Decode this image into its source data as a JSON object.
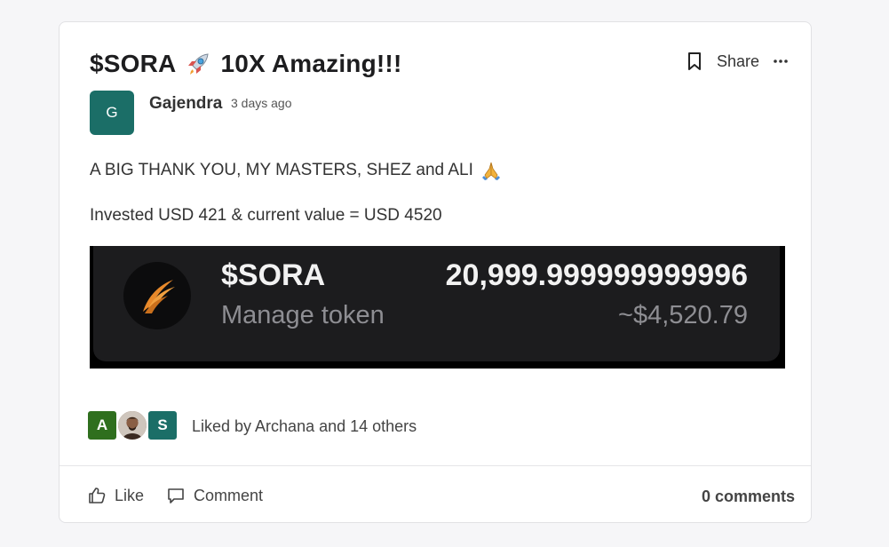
{
  "post": {
    "title": "$SORA",
    "title_suffix": "10X Amazing!!!",
    "author_initial": "G",
    "author": "Gajendra",
    "time": "3 days ago",
    "line1": "A BIG THANK YOU, MY MASTERS, SHEZ and ALI",
    "line2": "Invested USD 421 & current value = USD 4520",
    "share_label": "Share"
  },
  "token_image": {
    "name": "$SORA",
    "subtitle": "Manage token",
    "amount": "20,999.999999999996",
    "usd_value": "~$4,520.79"
  },
  "likes": {
    "avatars": [
      "A",
      "photo",
      "S"
    ],
    "text": "Liked by Archana and 14 others"
  },
  "actions": {
    "like_label": "Like",
    "comment_label": "Comment",
    "comments_count": "0 comments"
  },
  "colors": {
    "avatar_teal": "#1b6e67",
    "avatar_green": "#2f6f1e",
    "token_orange": "#e8892a"
  }
}
